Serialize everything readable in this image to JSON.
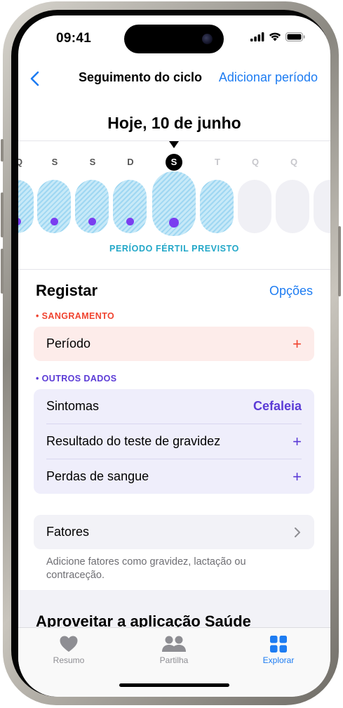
{
  "status": {
    "time": "09:41"
  },
  "nav": {
    "back_icon": "chevron-left-icon",
    "title": "Seguimento do ciclo",
    "action": "Adicionar período"
  },
  "date_header": "Hoje, 10 de junho",
  "calendar": {
    "day_letters": [
      "Q",
      "S",
      "S",
      "D",
      "S",
      "T",
      "Q",
      "Q"
    ],
    "today_letter": "S",
    "fertile_label": "PERÍODO FÉRTIL PREVISTO",
    "fertile_color": "#9fd7f2",
    "dot_color": "#7a3ef0"
  },
  "log": {
    "title": "Registar",
    "options": "Opções",
    "bleeding_label": "• SANGRAMENTO",
    "bleeding_color": "#f0432f",
    "period_row": {
      "label": "Período",
      "icon": "plus-icon"
    },
    "other_label": "• OUTROS DADOS",
    "other_color": "#5b3bd6",
    "other_rows": [
      {
        "label": "Sintomas",
        "value": "Cefaleia"
      },
      {
        "label": "Resultado do teste de gravidez",
        "icon": "plus-icon"
      },
      {
        "label": "Perdas de sangue",
        "icon": "plus-icon"
      }
    ],
    "factors_row": {
      "label": "Fatores",
      "icon": "chevron-right-icon"
    },
    "factors_hint": "Adicione fatores como gravidez, lactação ou contraceção."
  },
  "enjoy_title": "Aproveitar a aplicação Saúde",
  "tabbar": {
    "tabs": [
      {
        "label": "Resumo",
        "icon": "heart-icon"
      },
      {
        "label": "Partilha",
        "icon": "people-icon"
      },
      {
        "label": "Explorar",
        "icon": "grid-icon",
        "active": true
      }
    ]
  },
  "accent_color": "#1d7cf2"
}
